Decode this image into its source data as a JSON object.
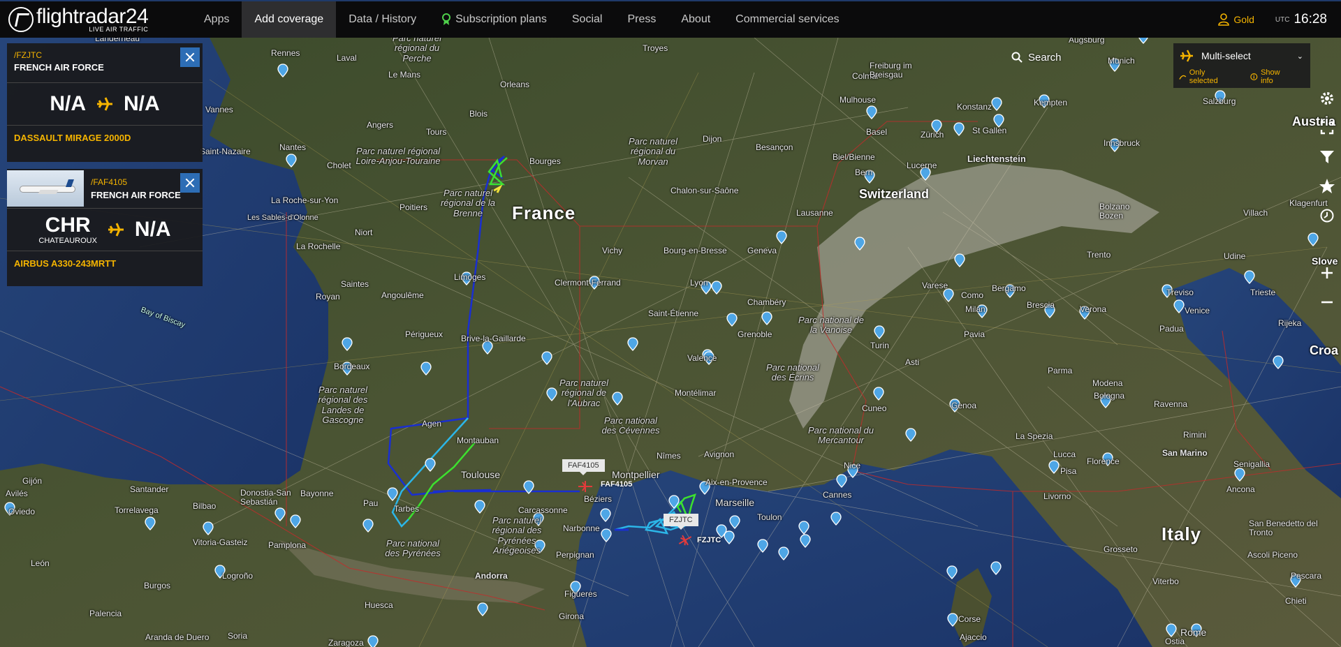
{
  "nav": {
    "brand": "flightradar24",
    "tagline": "LIVE AIR TRAFFIC",
    "items": [
      {
        "label": "Apps"
      },
      {
        "label": "Add coverage"
      },
      {
        "label": "Data / History"
      },
      {
        "label": "Subscription plans"
      },
      {
        "label": "Social"
      },
      {
        "label": "Press"
      },
      {
        "label": "About"
      },
      {
        "label": "Commercial services"
      }
    ],
    "active": "Add coverage",
    "account": "Gold",
    "utc_label": "UTC",
    "time": "16:28"
  },
  "flight_cards": [
    {
      "callsign": "/FZJTC",
      "operator": "FRENCH AIR FORCE",
      "origin": "N/A",
      "origin_city": "",
      "destination": "N/A",
      "aircraft_type": "DASSAULT MIRAGE 2000D"
    },
    {
      "callsign": "/FAF4105",
      "operator": "FRENCH AIR FORCE",
      "origin": "CHR",
      "origin_city": "CHATEAUROUX",
      "destination": "N/A",
      "aircraft_type": "AIRBUS A330-243MRTT"
    }
  ],
  "search": {
    "label": "Search"
  },
  "multi_select": {
    "label": "Multi-select",
    "only_selected": "Only selected",
    "show_info": "Show info"
  },
  "aircraft_on_map": [
    {
      "tag": "FAF4105",
      "code": "FAF4105"
    },
    {
      "tag": "FZJTC",
      "code": "FZJTC"
    }
  ],
  "map_labels": {
    "countries": [
      "France",
      "Switzerland",
      "Italy",
      "Austria",
      "Liechtenstein",
      "Slove",
      "Croa"
    ],
    "cities": [
      "Rennes",
      "Laval",
      "Le Mans",
      "Orleans",
      "Troyes",
      "Nantes",
      "Angers",
      "Tours",
      "Blois",
      "Bourges",
      "Dijon",
      "Besançon",
      "Mulhouse",
      "Colmar",
      "Freiburg im Breisgau",
      "Basel",
      "Zürich",
      "Konstanz",
      "St Gallen",
      "Kempten",
      "Munich",
      "Augsburg",
      "Salzburg",
      "Innsbruck",
      "Bern",
      "Biel/Bienne",
      "Lucerne",
      "Lausanne",
      "Geneva",
      "Poitiers",
      "Niort",
      "La Rochelle",
      "Limoges",
      "Clermont-Ferrand",
      "Vichy",
      "Lyon",
      "Bourg-en-Bresse",
      "Chalon-sur-Saône",
      "Cholet",
      "Saint-Nazaire",
      "La Roche-sur-Yon",
      "Les Sables-d'Olonne",
      "Angoulême",
      "Royan",
      "Saintes",
      "Périgueux",
      "Brive-la-Gaillarde",
      "Bordeaux",
      "Saint-Étienne",
      "Chambéry",
      "Grenoble",
      "Valence",
      "Montélimar",
      "Turin",
      "Milan",
      "Como",
      "Bergamo",
      "Brescia",
      "Verona",
      "Varese",
      "Pavia",
      "Asti",
      "Cuneo",
      "Genoa",
      "Parma",
      "Modena",
      "Bologna",
      "Ravenna",
      "Rimini",
      "San Marino",
      "Padua",
      "Venice",
      "Treviso",
      "Trieste",
      "Rijeka",
      "Udine",
      "Trento",
      "Bolzano Bozen",
      "Villach",
      "Klagenfurt",
      "La Spezia",
      "Lucca",
      "Pisa",
      "Livorno",
      "Florence",
      "Senigallia",
      "Ancona",
      "Grosseto",
      "Ascoli Piceno",
      "San Benedetto del Tronto",
      "Viterbo",
      "Pescara",
      "Chieti",
      "Rome",
      "Ostia",
      "Toulouse",
      "Montauban",
      "Agen",
      "Pau",
      "Tarbes",
      "Bayonne",
      "Donostia-San Sebastián",
      "Bilbao",
      "Santander",
      "Gijón",
      "Avilés",
      "Oviedo",
      "Torrelavega",
      "Vitoria-Gasteiz",
      "Pamplona",
      "Logroño",
      "León",
      "Burgos",
      "Palencia",
      "Soria",
      "Huesca",
      "Zaragoza",
      "Aranda de Duero",
      "Andorra",
      "Carcassonne",
      "Narbonne",
      "Perpignan",
      "Béziers",
      "Montpellier",
      "Nîmes",
      "Avignon",
      "Aix-en-Provence",
      "Marseille",
      "Toulon",
      "Cannes",
      "Nice",
      "Figueres",
      "Girona",
      "Ajaccio",
      "Corse",
      "Landerneau",
      "Vannes"
    ],
    "parks": [
      "Parc naturel régional du Perche",
      "Parc naturel régional Loire-Anjou-Touraine",
      "Parc naturel régional de la Brenne",
      "Parc naturel régional du Morvan",
      "Parc naturel régional des Landes de Gascogne",
      "Parc naturel régional de l'Aubrac",
      "Parc national des Cévennes",
      "Parc national des Écrins",
      "Parc national de la Vanoise",
      "Parc national du Mercantour",
      "Parc naturel régional des Pyrénées Ariégeoises",
      "Parc national des Pyrénées"
    ],
    "seas": [
      "Bay of Biscay"
    ]
  },
  "colors": {
    "accent": "#f5b400",
    "close_button": "#2d6db5",
    "nav_bg": "#0b0b0c",
    "panel_bg": "#1a1a1c",
    "track_blue": "#1a2fd0",
    "track_cyan": "#2cb6e8",
    "track_green": "#3de02f",
    "track_yellow": "#f2e33a",
    "aircraft": "#e23b3b",
    "border_red": "#c42a2a"
  },
  "icons": [
    "user-icon",
    "search-icon",
    "plane-icon",
    "close-icon",
    "gear-icon",
    "fullscreen-icon",
    "filter-icon",
    "star-icon",
    "history-icon",
    "zoom-in-icon",
    "zoom-out-icon",
    "pin-icon",
    "multi-select-icon"
  ]
}
